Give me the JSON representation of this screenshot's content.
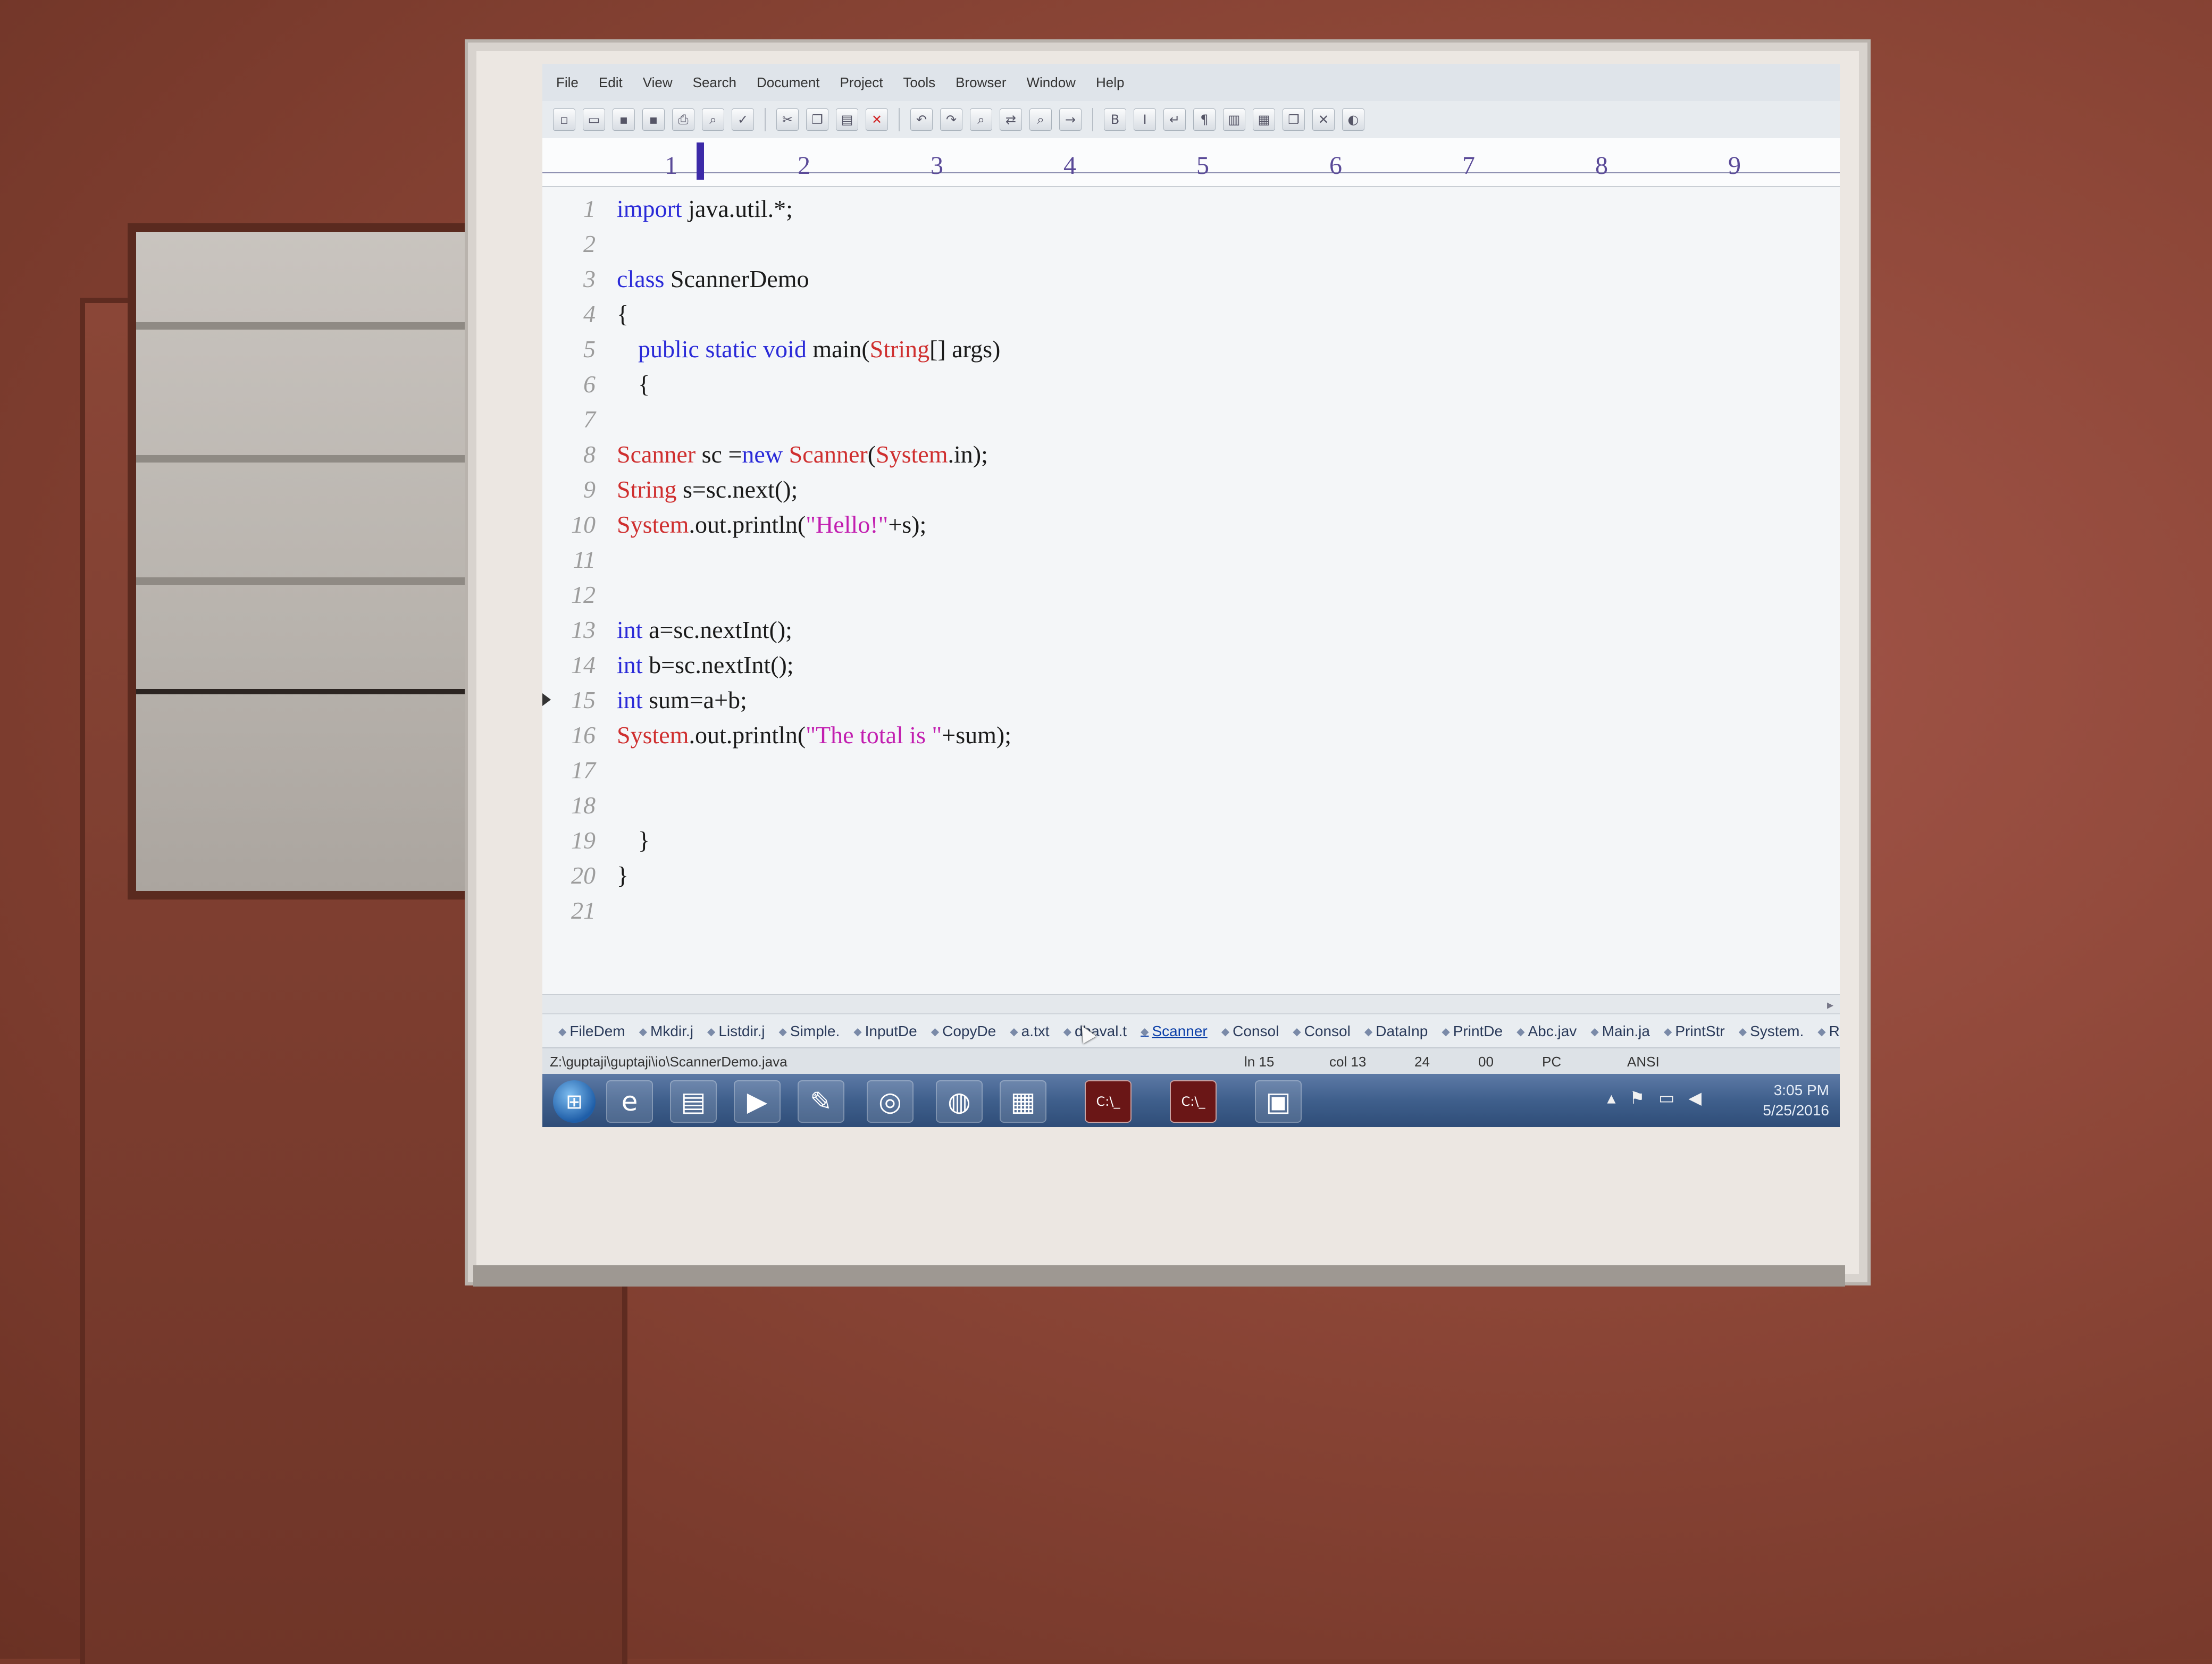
{
  "menu": [
    "File",
    "Edit",
    "View",
    "Search",
    "Document",
    "Project",
    "Tools",
    "Browser",
    "Window",
    "Help"
  ],
  "toolbar_icons": [
    "new-file-icon",
    "open-folder-icon",
    "save-icon",
    "save-all-icon",
    "print-icon",
    "print-preview-icon",
    "spell-check-icon",
    "cut-icon",
    "copy-icon",
    "paste-icon",
    "delete-icon",
    "undo-icon",
    "redo-icon",
    "find-icon",
    "replace-icon",
    "find-in-files-icon",
    "goto-icon",
    "bold-icon",
    "italic-icon",
    "word-wrap-icon",
    "show-spaces-icon",
    "column-mode-icon",
    "window-tile-icon",
    "window-cascade-icon",
    "close-window-icon",
    "toggle-icon"
  ],
  "ruler": [
    "1",
    "2",
    "3",
    "4",
    "5",
    "6",
    "7",
    "8",
    "9"
  ],
  "code_lines": [
    {
      "n": "1",
      "indent": 0,
      "parts": [
        {
          "t": "import",
          "c": "kw"
        },
        {
          "t": " java.util.*;",
          "c": ""
        }
      ]
    },
    {
      "n": "2",
      "indent": 0,
      "parts": []
    },
    {
      "n": "3",
      "indent": 0,
      "parts": [
        {
          "t": "class",
          "c": "kw"
        },
        {
          "t": " ScannerDemo",
          "c": ""
        }
      ]
    },
    {
      "n": "4",
      "indent": 0,
      "parts": [
        {
          "t": "{",
          "c": ""
        }
      ]
    },
    {
      "n": "5",
      "indent": 1,
      "parts": [
        {
          "t": "public static void",
          "c": "kw"
        },
        {
          "t": " main(",
          "c": ""
        },
        {
          "t": "String",
          "c": "ty"
        },
        {
          "t": "[] args)",
          "c": ""
        }
      ]
    },
    {
      "n": "6",
      "indent": 1,
      "parts": [
        {
          "t": "{",
          "c": ""
        }
      ]
    },
    {
      "n": "7",
      "indent": 0,
      "parts": []
    },
    {
      "n": "8",
      "indent": 0,
      "parts": [
        {
          "t": "Scanner",
          "c": "ty"
        },
        {
          "t": " sc =",
          "c": ""
        },
        {
          "t": "new",
          "c": "kw"
        },
        {
          "t": " ",
          "c": ""
        },
        {
          "t": "Scanner",
          "c": "ty"
        },
        {
          "t": "(",
          "c": ""
        },
        {
          "t": "System",
          "c": "ty"
        },
        {
          "t": ".in);",
          "c": ""
        }
      ]
    },
    {
      "n": "9",
      "indent": 0,
      "parts": [
        {
          "t": "String",
          "c": "ty"
        },
        {
          "t": " s=sc.next();",
          "c": ""
        }
      ]
    },
    {
      "n": "10",
      "indent": 0,
      "parts": [
        {
          "t": "System",
          "c": "ty"
        },
        {
          "t": ".out.println(",
          "c": ""
        },
        {
          "t": "\"Hello!\"",
          "c": "st"
        },
        {
          "t": "+s);",
          "c": ""
        }
      ]
    },
    {
      "n": "11",
      "indent": 0,
      "parts": []
    },
    {
      "n": "12",
      "indent": 0,
      "parts": []
    },
    {
      "n": "13",
      "indent": 0,
      "parts": [
        {
          "t": "int",
          "c": "kw"
        },
        {
          "t": " a=sc.nextInt();",
          "c": ""
        }
      ]
    },
    {
      "n": "14",
      "indent": 0,
      "parts": [
        {
          "t": "int",
          "c": "kw"
        },
        {
          "t": " b=sc.nextInt();",
          "c": ""
        }
      ]
    },
    {
      "n": "15",
      "indent": 0,
      "marker": true,
      "parts": [
        {
          "t": "int",
          "c": "kw"
        },
        {
          "t": " sum=a+b;",
          "c": ""
        }
      ]
    },
    {
      "n": "16",
      "indent": 0,
      "parts": [
        {
          "t": "System",
          "c": "ty"
        },
        {
          "t": ".out.println(",
          "c": ""
        },
        {
          "t": "\"The total is \"",
          "c": "st"
        },
        {
          "t": "+sum);",
          "c": ""
        }
      ]
    },
    {
      "n": "17",
      "indent": 0,
      "parts": []
    },
    {
      "n": "18",
      "indent": 0,
      "parts": []
    },
    {
      "n": "19",
      "indent": 1,
      "parts": [
        {
          "t": "}",
          "c": ""
        }
      ]
    },
    {
      "n": "20",
      "indent": 0,
      "parts": [
        {
          "t": "}",
          "c": ""
        }
      ]
    },
    {
      "n": "21",
      "indent": 0,
      "parts": []
    }
  ],
  "file_tabs": [
    {
      "label": "FileDem",
      "active": false
    },
    {
      "label": "Mkdir.j",
      "active": false
    },
    {
      "label": "Listdir.j",
      "active": false
    },
    {
      "label": "Simple.",
      "active": false
    },
    {
      "label": "InputDe",
      "active": false
    },
    {
      "label": "CopyDe",
      "active": false
    },
    {
      "label": "a.txt",
      "active": false
    },
    {
      "label": "dhaval.t",
      "active": false
    },
    {
      "label": "Scanner",
      "active": true
    },
    {
      "label": "Consol",
      "active": false
    },
    {
      "label": "Consol",
      "active": false
    },
    {
      "label": "DataInp",
      "active": false
    },
    {
      "label": "PrintDe",
      "active": false
    },
    {
      "label": "Abc.jav",
      "active": false
    },
    {
      "label": "Main.ja",
      "active": false
    },
    {
      "label": "PrintStr",
      "active": false
    },
    {
      "label": "System.",
      "active": false
    },
    {
      "label": "Randon",
      "active": false
    }
  ],
  "status": {
    "path": "Z:\\guptaji\\guptaji\\io\\ScannerDemo.java",
    "line": "ln 15",
    "col": "col 13",
    "chars": "24",
    "mode": "00",
    "format": "PC",
    "encoding": "ANSI"
  },
  "taskbar": {
    "apps": [
      {
        "name": "start-button"
      },
      {
        "name": "internet-explorer-icon",
        "glyph": "e"
      },
      {
        "name": "file-explorer-icon",
        "glyph": "▤"
      },
      {
        "name": "media-player-icon",
        "glyph": "▶"
      },
      {
        "name": "acrobat-icon",
        "glyph": "✎"
      },
      {
        "name": "chrome-icon",
        "glyph": "◎"
      },
      {
        "name": "firefox-icon",
        "glyph": "◍"
      },
      {
        "name": "editor-icon",
        "glyph": "▦"
      },
      {
        "name": "cmd-window-1",
        "glyph": "C:\\_"
      },
      {
        "name": "cmd-window-2",
        "glyph": "C:\\_"
      },
      {
        "name": "image-viewer-icon",
        "glyph": "▣"
      }
    ],
    "time": "3:05 PM",
    "date": "5/25/2016"
  },
  "colors": {
    "keyword": "#2a2ad8",
    "type": "#cf2f2f",
    "string": "#c21fb0",
    "taskbar": "#3f5f8c"
  }
}
